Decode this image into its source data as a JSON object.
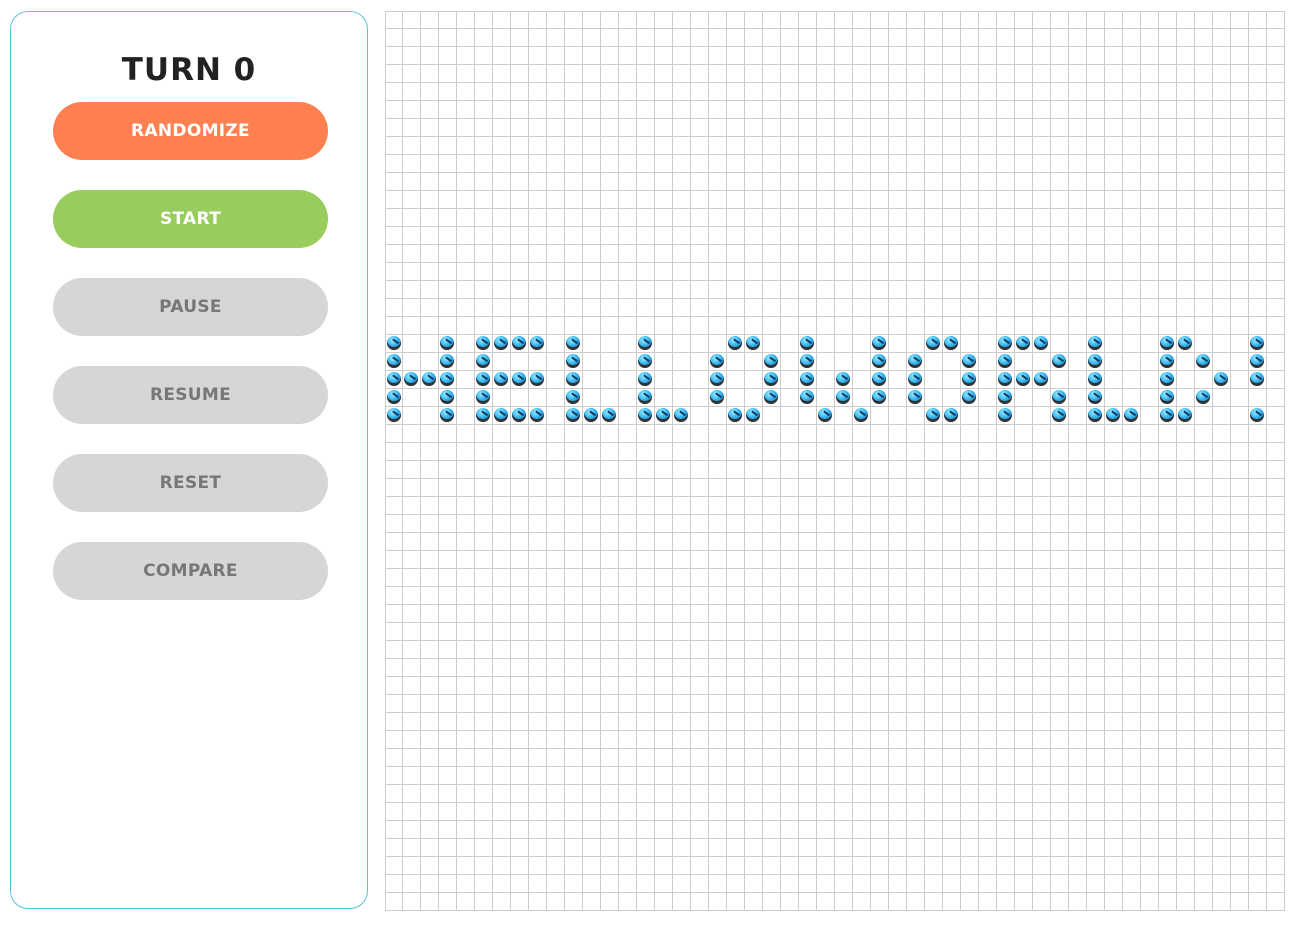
{
  "controls": {
    "turn_label": "TURN 0",
    "randomize_label": "RANDOMIZE",
    "start_label": "START",
    "pause_label": "PAUSE",
    "resume_label": "RESUME",
    "reset_label": "RESET",
    "compare_label": "COMPARE"
  },
  "colors": {
    "panel_border": "#5bc0de",
    "randomize": "#fe8050",
    "start": "#98cd5d",
    "disabled": "#d6d6d6",
    "grid_line": "#cccccc",
    "cell_alive": "#36b8f2"
  },
  "board": {
    "rows": 50,
    "cols": 50,
    "live_cell_icon": "bird-icon",
    "live_pattern": [
      "#..#.####.#...#....##..#...#..##..###..#...##...#",
      "#..#.#....#...#...#..#.#...#.#..#.#..#.#...#.#..#",
      "####.####.#...#...#..#.#.#.#.#..#.###..#...#..#.#",
      "#..#.#....#...#...#..#.#.#.#.#..#.#..#.#...#.#...",
      "#..#.####.###.###..##...#.#...##..#..#.###.##...#"
    ],
    "pattern_top_row": 18
  }
}
